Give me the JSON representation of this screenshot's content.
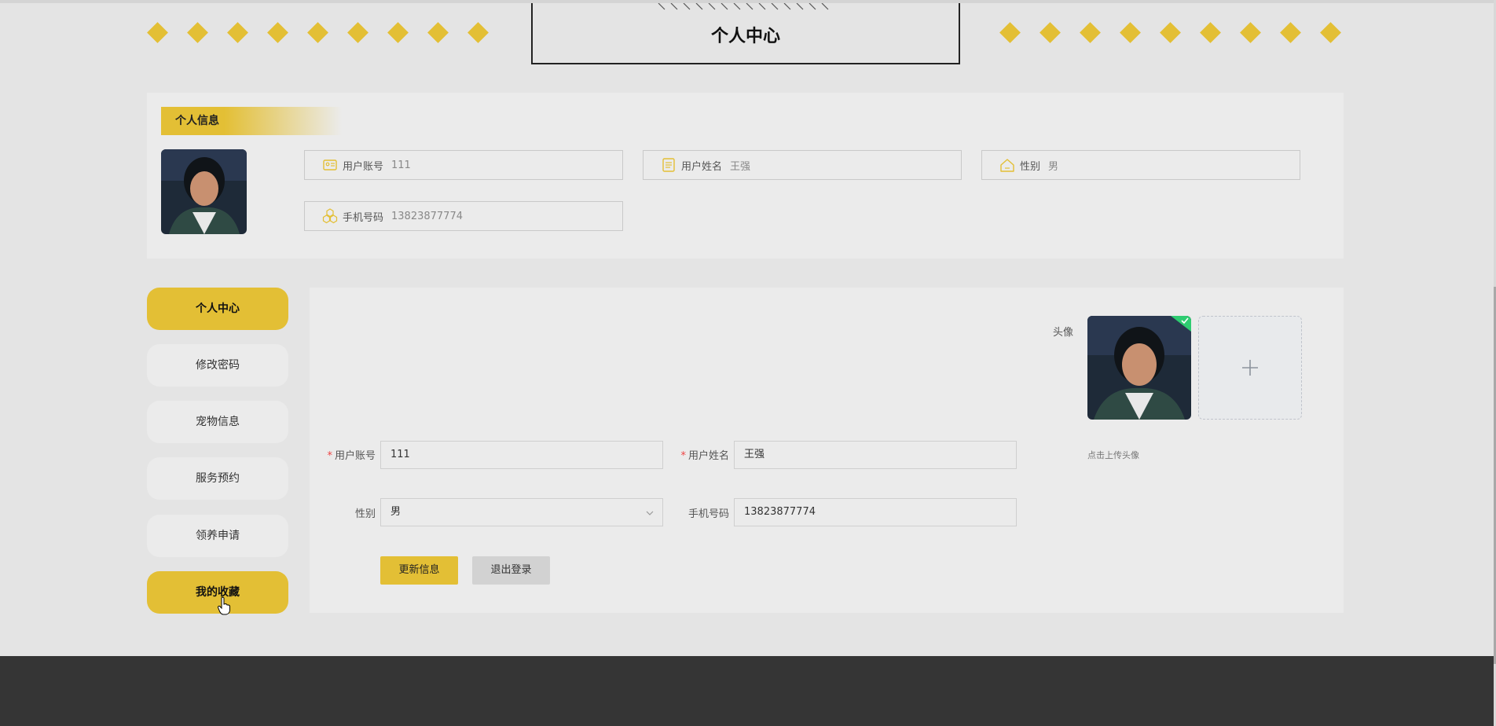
{
  "page": {
    "title": "个人中心"
  },
  "colors": {
    "accent": "#e3bf35",
    "background": "#e4e4e4",
    "panel": "#ebebeb",
    "footer": "#353535"
  },
  "info": {
    "section_title": "个人信息",
    "fields": [
      {
        "icon": "id-card-icon",
        "label": "用户账号",
        "value": "111"
      },
      {
        "icon": "note-icon",
        "label": "用户姓名",
        "value": "王强"
      },
      {
        "icon": "home-icon",
        "label": "性别",
        "value": "男"
      },
      {
        "icon": "cubes-icon",
        "label": "手机号码",
        "value": "13823877774"
      }
    ]
  },
  "menu": [
    {
      "label": "个人中心",
      "active": true
    },
    {
      "label": "修改密码",
      "active": false
    },
    {
      "label": "宠物信息",
      "active": false
    },
    {
      "label": "服务预约",
      "active": false
    },
    {
      "label": "领养申请",
      "active": false
    },
    {
      "label": "我的收藏",
      "active": true
    }
  ],
  "form": {
    "account": {
      "label": "用户账号",
      "required": "*",
      "value": "111"
    },
    "name": {
      "label": "用户姓名",
      "required": "*",
      "value": "王强"
    },
    "gender": {
      "label": "性别",
      "value": "男"
    },
    "phone": {
      "label": "手机号码",
      "value": "13823877774"
    },
    "avatar": {
      "label": "头像",
      "hint": "点击上传头像"
    },
    "update_button": "更新信息",
    "logout_button": "退出登录"
  }
}
